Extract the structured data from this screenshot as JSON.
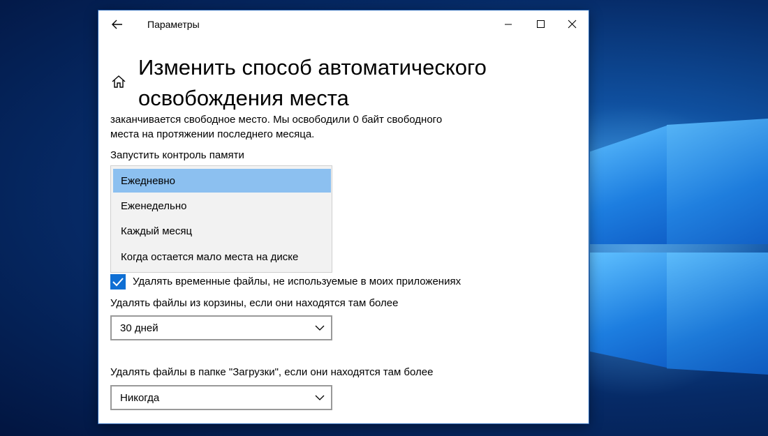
{
  "window": {
    "title": "Параметры"
  },
  "page": {
    "title_line1": "Изменить способ автоматического",
    "title_line2": "освобождения места",
    "desc_line1": "заканчивается свободное место. Мы освободили 0 байт свободного",
    "desc_line2": "места на протяжении последнего месяца."
  },
  "run_storage_sense": {
    "label": "Запустить контроль памяти",
    "options": [
      {
        "label": "Ежедневно",
        "selected": true
      },
      {
        "label": "Еженедельно",
        "selected": false
      },
      {
        "label": "Каждый месяц",
        "selected": false
      },
      {
        "label": "Когда остается мало места на диске",
        "selected": false
      }
    ]
  },
  "temp_files": {
    "label": "Удалять временные файлы, не используемые в моих приложениях",
    "checked": true
  },
  "recycle_bin": {
    "label": "Удалять файлы из корзины, если они находятся там более",
    "value": "30 дней"
  },
  "downloads": {
    "label": "Удалять файлы в папке \"Загрузки\", если они находятся там более",
    "value": "Никогда"
  },
  "icons": [
    "back-arrow-icon",
    "minimize-icon",
    "maximize-icon",
    "close-icon",
    "home-icon",
    "checkmark-icon",
    "chevron-down-icon"
  ],
  "colors": {
    "accent": "#0f6fd4",
    "selected_option": "#8cc0f0",
    "desktop": "#0f4f9e"
  }
}
